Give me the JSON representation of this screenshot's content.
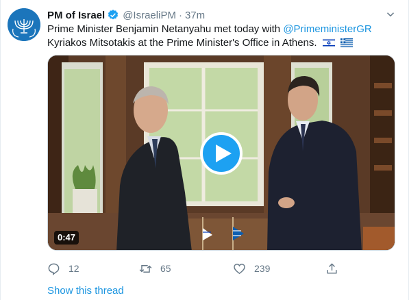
{
  "tweet": {
    "author_name": "PM of Israel",
    "handle": "@IsraeliPM",
    "separator": "·",
    "time": "37m",
    "text_line1": "Prime Minister Benjamin Netanyahu met today with",
    "mention": "@PrimeministerGR",
    "text_line2": "Kyriakos Mitsotakis at the Prime Minister's Office in Athens.",
    "flags": [
      "israel-flag-emoji",
      "greece-flag-emoji"
    ]
  },
  "media": {
    "duration": "0:47",
    "play_icon": "play-icon"
  },
  "actions": {
    "reply_count": "12",
    "retweet_count": "65",
    "like_count": "239"
  },
  "show_thread_label": "Show this thread",
  "colors": {
    "link": "#1b95e0",
    "play_button": "#1da1f2",
    "secondary_text": "#657786",
    "avatar_bg": "#1b75bb"
  }
}
